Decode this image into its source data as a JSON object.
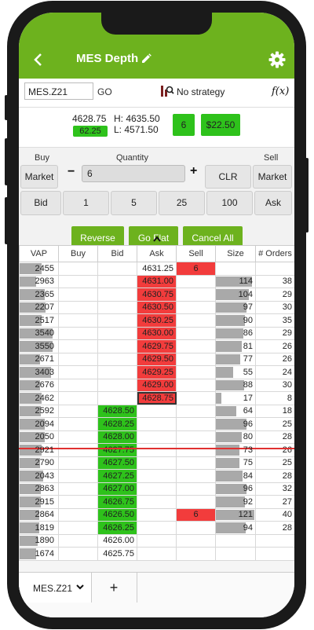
{
  "header": {
    "title": "MES Depth",
    "back_icon": "back-arrow-icon",
    "settings_icon": "gear-icon",
    "accent": "#6db21e"
  },
  "toolbar": {
    "symbol": "MES.Z21",
    "go_label": "GO",
    "strategy_label": "No strategy",
    "fx_label": "f(x)"
  },
  "quote": {
    "last": "4628.75",
    "change": "62.25",
    "high": "H: 4635.50",
    "low": "L: 4571.50",
    "position": "6",
    "pnl": "$22.50"
  },
  "order_entry": {
    "buy_label": "Buy",
    "sell_label": "Sell",
    "quantity_label": "Quantity",
    "market_buy": "Market",
    "market_sell": "Market",
    "minus": "−",
    "plus": "+",
    "quantity": "6",
    "clear": "CLR",
    "bid": "Bid",
    "q1": "1",
    "q2": "5",
    "q3": "25",
    "q4": "100",
    "ask": "Ask"
  },
  "actions": {
    "reverse": "Reverse",
    "flat": "Go Flat",
    "cancel": "Cancel All"
  },
  "ladder": {
    "columns": [
      "VAP",
      "Buy",
      "Bid",
      "Ask",
      "Sell",
      "Size",
      "# Orders"
    ],
    "rows": [
      {
        "vap": "2455",
        "vapf": 0.58,
        "bid": "",
        "ask": "4631.25",
        "askc": "plain",
        "sell": "6",
        "size": "",
        "sizef": 0,
        "orders": ""
      },
      {
        "vap": "2963",
        "vapf": 0.42,
        "bid": "",
        "ask": "4631.00",
        "askc": "red",
        "sell": "",
        "size": "114",
        "sizef": 0.92,
        "orders": "38"
      },
      {
        "vap": "2365",
        "vapf": 0.65,
        "bid": "",
        "ask": "4630.75",
        "askc": "red",
        "sell": "",
        "size": "104",
        "sizef": 0.84,
        "orders": "29"
      },
      {
        "vap": "2207",
        "vapf": 0.68,
        "bid": "",
        "ask": "4630.50",
        "askc": "red",
        "sell": "",
        "size": "97",
        "sizef": 0.78,
        "orders": "30"
      },
      {
        "vap": "2517",
        "vapf": 0.58,
        "bid": "",
        "ask": "4630.25",
        "askc": "red",
        "sell": "",
        "size": "90",
        "sizef": 0.73,
        "orders": "35"
      },
      {
        "vap": "3540",
        "vapf": 0.86,
        "bid": "",
        "ask": "4630.00",
        "askc": "red",
        "sell": "",
        "size": "86",
        "sizef": 0.69,
        "orders": "29"
      },
      {
        "vap": "3550",
        "vapf": 0.86,
        "bid": "",
        "ask": "4629.75",
        "askc": "red",
        "sell": "",
        "size": "81",
        "sizef": 0.65,
        "orders": "26"
      },
      {
        "vap": "2671",
        "vapf": 0.54,
        "bid": "",
        "ask": "4629.50",
        "askc": "red",
        "sell": "",
        "size": "77",
        "sizef": 0.62,
        "orders": "26"
      },
      {
        "vap": "3403",
        "vapf": 0.82,
        "bid": "",
        "ask": "4629.25",
        "askc": "red",
        "sell": "",
        "size": "55",
        "sizef": 0.44,
        "orders": "24"
      },
      {
        "vap": "2676",
        "vapf": 0.54,
        "bid": "",
        "ask": "4629.00",
        "askc": "red",
        "sell": "",
        "size": "88",
        "sizef": 0.71,
        "orders": "30"
      },
      {
        "vap": "2462",
        "vapf": 0.58,
        "bid": "",
        "ask": "4628.75",
        "askc": "box",
        "sell": "",
        "size": "17",
        "sizef": 0.14,
        "orders": "8"
      },
      {
        "vap": "2592",
        "vapf": 0.56,
        "bid": "4628.50",
        "ask": "",
        "askc": "plain",
        "sell": "",
        "size": "64",
        "sizef": 0.52,
        "orders": "18"
      },
      {
        "vap": "2094",
        "vapf": 0.66,
        "bid": "4628.25",
        "ask": "",
        "askc": "plain",
        "sell": "",
        "size": "96",
        "sizef": 0.77,
        "orders": "25"
      },
      {
        "vap": "2050",
        "vapf": 0.66,
        "bid": "4628.00",
        "ask": "",
        "askc": "plain",
        "sell": "",
        "size": "80",
        "sizef": 0.65,
        "orders": "28"
      },
      {
        "vap": "2921",
        "vapf": 0.58,
        "bid": "4627.75",
        "ask": "",
        "askc": "plain",
        "sell": "",
        "size": "73",
        "sizef": 0.59,
        "orders": "26"
      },
      {
        "vap": "2790",
        "vapf": 0.54,
        "bid": "4627.50",
        "ask": "",
        "askc": "plain",
        "sell": "",
        "size": "75",
        "sizef": 0.6,
        "orders": "25"
      },
      {
        "vap": "2043",
        "vapf": 0.62,
        "bid": "4627.25",
        "ask": "",
        "askc": "plain",
        "sell": "",
        "size": "84",
        "sizef": 0.68,
        "orders": "28"
      },
      {
        "vap": "2863",
        "vapf": 0.56,
        "bid": "4627.00",
        "ask": "",
        "askc": "plain",
        "sell": "",
        "size": "96",
        "sizef": 0.77,
        "orders": "32"
      },
      {
        "vap": "2915",
        "vapf": 0.56,
        "bid": "4626.75",
        "ask": "",
        "askc": "plain",
        "sell": "",
        "size": "92",
        "sizef": 0.74,
        "orders": "27"
      },
      {
        "vap": "2864",
        "vapf": 0.52,
        "bid": "4626.50",
        "ask": "",
        "askc": "plain",
        "sell": "6",
        "size": "121",
        "sizef": 0.97,
        "orders": "40"
      },
      {
        "vap": "1819",
        "vapf": 0.5,
        "bid": "4626.25",
        "ask": "",
        "askc": "plain",
        "sell": "",
        "size": "94",
        "sizef": 0.76,
        "orders": "28"
      },
      {
        "vap": "1890",
        "vapf": 0.46,
        "bid": "4626.00",
        "ask": "",
        "askc": "plain",
        "sell": "",
        "size": "",
        "sizef": 0,
        "orders": ""
      },
      {
        "vap": "1674",
        "vapf": 0.42,
        "bid": "4625.75",
        "ask": "",
        "askc": "plain",
        "sell": "",
        "size": "",
        "sizef": 0,
        "orders": ""
      }
    ]
  },
  "footer": {
    "tab": "MES.Z21",
    "add": "+"
  }
}
